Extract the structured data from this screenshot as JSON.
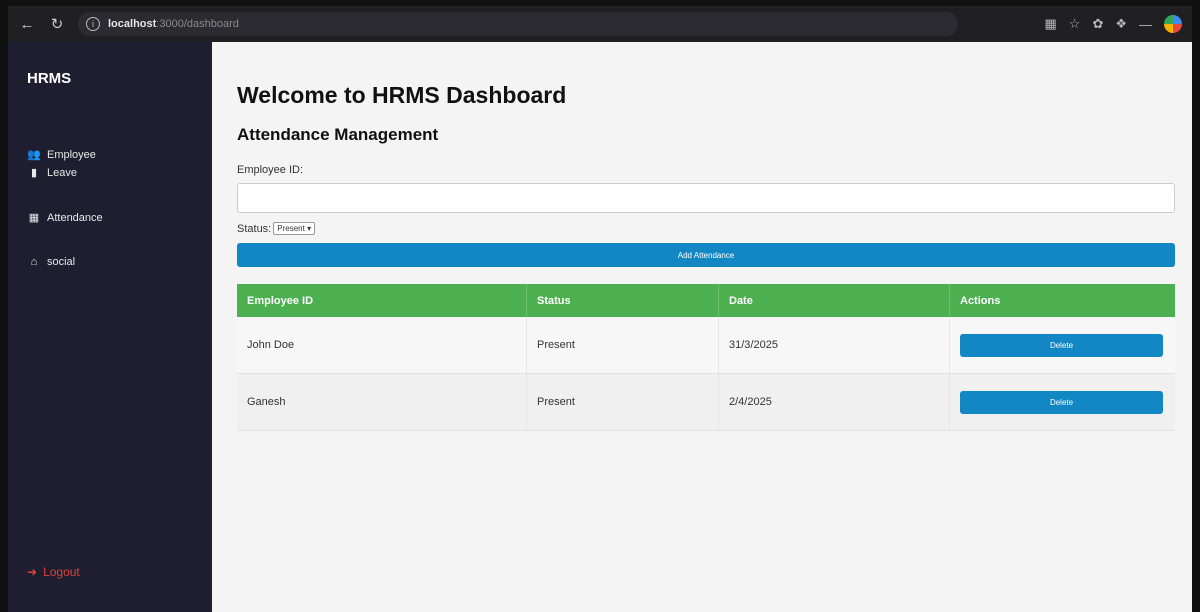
{
  "browser": {
    "url_host": "localhost",
    "url_path": ":3000/dashboard"
  },
  "sidebar": {
    "brand": "HRMS",
    "items": [
      {
        "icon": "users-icon",
        "label": "Employee"
      },
      {
        "icon": "clipboard-icon",
        "label": "Leave"
      },
      {
        "icon": "calendar-icon",
        "label": "Attendance"
      },
      {
        "icon": "home-icon",
        "label": "social"
      }
    ],
    "logout": "Logout"
  },
  "main": {
    "title": "Welcome to HRMS Dashboard",
    "section_title": "Attendance Management",
    "employee_id_label": "Employee ID:",
    "employee_id_value": "",
    "status_label": "Status:",
    "status_value": "Present",
    "add_button": "Add Attendance"
  },
  "table": {
    "headers": [
      "Employee ID",
      "Status",
      "Date",
      "Actions"
    ],
    "rows": [
      {
        "employee": "John Doe",
        "status": "Present",
        "date": "31/3/2025",
        "action": "Delete"
      },
      {
        "employee": "Ganesh",
        "status": "Present",
        "date": "2/4/2025",
        "action": "Delete"
      }
    ]
  },
  "colors": {
    "sidebar_bg": "#1e1e30",
    "accent_blue": "#1287c4",
    "header_green": "#4caf50",
    "logout_red": "#e0413a"
  }
}
